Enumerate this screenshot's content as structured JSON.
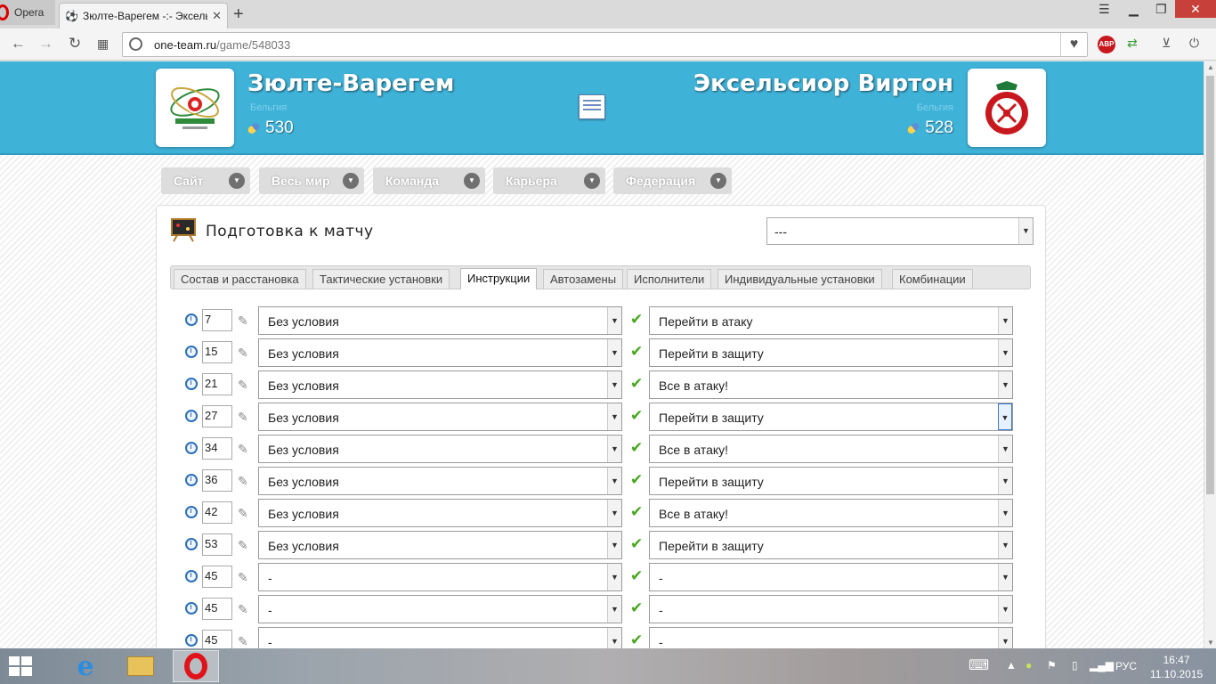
{
  "browser": {
    "menu_label": "Opera",
    "tab_title": "Зюлте-Варегем -:- Эксельсиор Виртон",
    "url_domain": "one-team.ru",
    "url_path": "/game/548033",
    "abp_label": "ABP"
  },
  "match": {
    "home": {
      "name": "Зюлте-Варегем",
      "country": "Бельгия",
      "rating": "530"
    },
    "away": {
      "name": "Эксельсиор Виртон",
      "country": "Бельгия",
      "rating": "528"
    }
  },
  "nav": [
    {
      "label": "Сайт"
    },
    {
      "label": "Весь мир"
    },
    {
      "label": "Команда"
    },
    {
      "label": "Карьера"
    },
    {
      "label": "Федерация"
    }
  ],
  "panel": {
    "title": "Подготовка к матчу",
    "select_value": "---"
  },
  "tabs": [
    {
      "label": "Состав и расстановка"
    },
    {
      "label": "Тактические установки"
    },
    {
      "label": "Инструкции"
    },
    {
      "label": "Автозамены"
    },
    {
      "label": "Исполнители"
    },
    {
      "label": "Индивидуальные установки"
    },
    {
      "label": "Комбинации"
    }
  ],
  "instructions": [
    {
      "minute": "7",
      "condition": "Без условия",
      "action": "Перейти в атаку"
    },
    {
      "minute": "15",
      "condition": "Без условия",
      "action": "Перейти в защиту"
    },
    {
      "minute": "21",
      "condition": "Без условия",
      "action": "Все в атаку!"
    },
    {
      "minute": "27",
      "condition": "Без условия",
      "action": "Перейти в защиту"
    },
    {
      "minute": "34",
      "condition": "Без условия",
      "action": "Все в атаку!"
    },
    {
      "minute": "36",
      "condition": "Без условия",
      "action": "Перейти в защиту"
    },
    {
      "minute": "42",
      "condition": "Без условия",
      "action": "Все в атаку!"
    },
    {
      "minute": "53",
      "condition": "Без условия",
      "action": "Перейти в защиту"
    },
    {
      "minute": "45",
      "condition": "-",
      "action": "-"
    },
    {
      "minute": "45",
      "condition": "-",
      "action": "-"
    },
    {
      "minute": "45",
      "condition": "-",
      "action": "-"
    }
  ],
  "taskbar": {
    "lang": "РУС",
    "time": "16:47",
    "date": "11.10.2015"
  },
  "colors": {
    "banner": "#3fb2d8",
    "check": "#47a81d",
    "clock_icon": "#2c6fb8"
  }
}
